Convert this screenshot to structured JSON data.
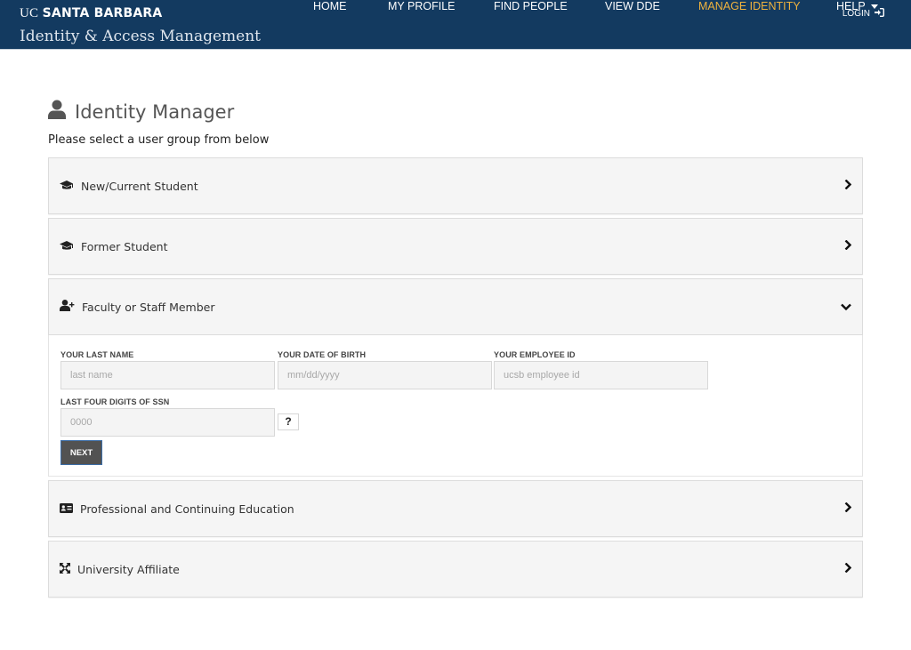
{
  "header": {
    "brand_uc": "UC",
    "brand_name": "SANTA BARBARA",
    "app_title": "Identity & Access Management",
    "login_label": "LOGIN",
    "nav": [
      {
        "label": "HOME",
        "active": false
      },
      {
        "label": "MY PROFILE",
        "active": false
      },
      {
        "label": "FIND PEOPLE",
        "active": false
      },
      {
        "label": "VIEW DDE",
        "active": false
      },
      {
        "label": "MANAGE IDENTITY",
        "active": true
      },
      {
        "label": "HELP",
        "active": false,
        "dropdown": true
      }
    ],
    "active_color": "#f0b33d",
    "bar_color": "#133a60"
  },
  "main": {
    "title": "Identity Manager",
    "subtitle": "Please select a user group from below",
    "groups": [
      {
        "label": "New/Current Student",
        "icon": "graduation-cap-icon",
        "expanded": false
      },
      {
        "label": "Former Student",
        "icon": "graduation-cap-icon",
        "expanded": false
      },
      {
        "label": "Faculty or Staff Member",
        "icon": "user-plus-icon",
        "expanded": true
      },
      {
        "label": "Professional and Continuing Education",
        "icon": "id-card-icon",
        "expanded": false
      },
      {
        "label": "University Affiliate",
        "icon": "expand-arrows-icon",
        "expanded": false
      }
    ],
    "form": {
      "last_name": {
        "label": "YOUR LAST NAME",
        "placeholder": "last name",
        "value": ""
      },
      "dob": {
        "label": "YOUR DATE OF BIRTH",
        "placeholder": "mm/dd/yyyy",
        "value": ""
      },
      "employee_id": {
        "label": "YOUR EMPLOYEE ID",
        "placeholder": "ucsb employee id",
        "value": ""
      },
      "ssn": {
        "label": "LAST FOUR DIGITS OF SSN",
        "placeholder": "0000",
        "value": ""
      },
      "help_label": "?",
      "next_label": "NEXT"
    }
  }
}
